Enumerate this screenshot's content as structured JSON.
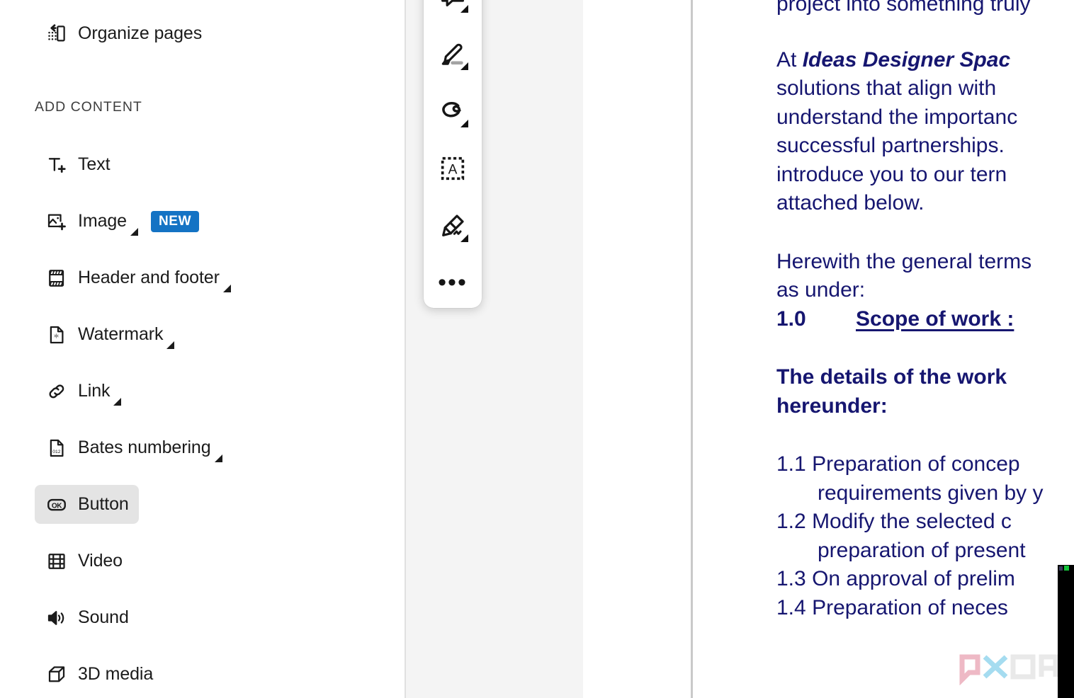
{
  "sidebar": {
    "top_item": {
      "label": "Organize pages",
      "icon": "organize-pages-icon"
    },
    "section_title": "ADD CONTENT",
    "items": [
      {
        "label": "Text",
        "icon": "text-add-icon",
        "caret": false,
        "badge": null,
        "selected": false
      },
      {
        "label": "Image",
        "icon": "image-add-icon",
        "caret": true,
        "badge": "NEW",
        "selected": false
      },
      {
        "label": "Header and footer",
        "icon": "header-footer-icon",
        "caret": true,
        "badge": null,
        "selected": false
      },
      {
        "label": "Watermark",
        "icon": "watermark-icon",
        "caret": true,
        "badge": null,
        "selected": false
      },
      {
        "label": "Link",
        "icon": "link-icon",
        "caret": true,
        "badge": null,
        "selected": false
      },
      {
        "label": "Bates numbering",
        "icon": "bates-numbering-icon",
        "caret": true,
        "badge": null,
        "selected": false
      },
      {
        "label": "Button",
        "icon": "ok-button-icon",
        "caret": false,
        "badge": null,
        "selected": true
      },
      {
        "label": "Video",
        "icon": "video-icon",
        "caret": false,
        "badge": null,
        "selected": false
      },
      {
        "label": "Sound",
        "icon": "sound-icon",
        "caret": false,
        "badge": null,
        "selected": false
      },
      {
        "label": "3D media",
        "icon": "cube-3d-icon",
        "caret": false,
        "badge": null,
        "selected": false
      }
    ],
    "badge_color": "#1473c4",
    "selected_bg": "#e4e4e4"
  },
  "toolbar": {
    "buttons": [
      {
        "name": "sticky-note-comment-icon",
        "caret": true
      },
      {
        "name": "highlighter-icon",
        "caret": true
      },
      {
        "name": "freehand-draw-icon",
        "caret": true
      },
      {
        "name": "text-box-icon",
        "caret": false
      },
      {
        "name": "signature-pen-icon",
        "caret": true
      },
      {
        "name": "more-options-icon",
        "caret": false,
        "glyph": "•••"
      }
    ]
  },
  "document": {
    "text_color": "#161670",
    "line_top_partial": "project into something truly",
    "para_at": {
      "lead": "At ",
      "bold_italic": "Ideas Designer Spac",
      "lines": [
        "solutions  that  align  with",
        "understand  the  importanc",
        "successful   partnerships.",
        "introduce  you  to  our  tern",
        "attached below."
      ]
    },
    "para_herewith": [
      "Herewith  the  general  terms",
      "as under:"
    ],
    "scope": {
      "number": "1.0",
      "title": "Scope of work :"
    },
    "details_heading": [
      "The  details  of  the  work",
      "hereunder:"
    ],
    "clauses": [
      {
        "num": "1.1",
        "line1": "Preparation   of   concep",
        "line2": "requirements given by y"
      },
      {
        "num": "1.2",
        "line1": "Modify  the  selected  c",
        "line2": "preparation of present"
      },
      {
        "num": "1.3",
        "line1": "On approval of prelim",
        "line2": null
      },
      {
        "num": "1.4",
        "line1": "Preparation  of  neces",
        "line2": null
      }
    ]
  },
  "watermark": {
    "text": "XDA"
  }
}
